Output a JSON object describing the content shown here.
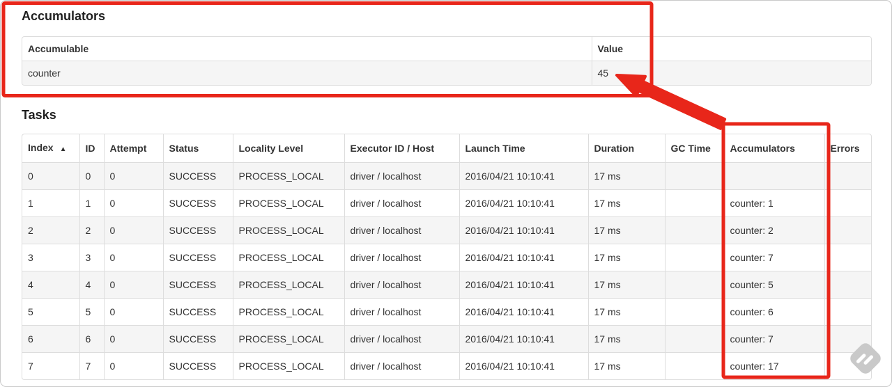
{
  "accumulators": {
    "title": "Accumulators",
    "columns": [
      "Accumulable",
      "Value"
    ],
    "rows": [
      [
        "counter",
        "45"
      ]
    ]
  },
  "tasks": {
    "title": "Tasks",
    "columns": [
      "Index",
      "ID",
      "Attempt",
      "Status",
      "Locality Level",
      "Executor ID / Host",
      "Launch Time",
      "Duration",
      "GC Time",
      "Accumulators",
      "Errors"
    ],
    "sort_indicator": "▲",
    "rows": [
      [
        "0",
        "0",
        "0",
        "SUCCESS",
        "PROCESS_LOCAL",
        "driver / localhost",
        "2016/04/21 10:10:41",
        "17 ms",
        "",
        "",
        ""
      ],
      [
        "1",
        "1",
        "0",
        "SUCCESS",
        "PROCESS_LOCAL",
        "driver / localhost",
        "2016/04/21 10:10:41",
        "17 ms",
        "",
        "counter: 1",
        ""
      ],
      [
        "2",
        "2",
        "0",
        "SUCCESS",
        "PROCESS_LOCAL",
        "driver / localhost",
        "2016/04/21 10:10:41",
        "17 ms",
        "",
        "counter: 2",
        ""
      ],
      [
        "3",
        "3",
        "0",
        "SUCCESS",
        "PROCESS_LOCAL",
        "driver / localhost",
        "2016/04/21 10:10:41",
        "17 ms",
        "",
        "counter: 7",
        ""
      ],
      [
        "4",
        "4",
        "0",
        "SUCCESS",
        "PROCESS_LOCAL",
        "driver / localhost",
        "2016/04/21 10:10:41",
        "17 ms",
        "",
        "counter: 5",
        ""
      ],
      [
        "5",
        "5",
        "0",
        "SUCCESS",
        "PROCESS_LOCAL",
        "driver / localhost",
        "2016/04/21 10:10:41",
        "17 ms",
        "",
        "counter: 6",
        ""
      ],
      [
        "6",
        "6",
        "0",
        "SUCCESS",
        "PROCESS_LOCAL",
        "driver / localhost",
        "2016/04/21 10:10:41",
        "17 ms",
        "",
        "counter: 7",
        ""
      ],
      [
        "7",
        "7",
        "0",
        "SUCCESS",
        "PROCESS_LOCAL",
        "driver / localhost",
        "2016/04/21 10:10:41",
        "17 ms",
        "",
        "counter: 17",
        ""
      ]
    ]
  },
  "annotations": {
    "highlight_color": "#e8261a"
  },
  "watermark": {
    "icon": "feedly-logo",
    "color": "#c9c9c9"
  }
}
